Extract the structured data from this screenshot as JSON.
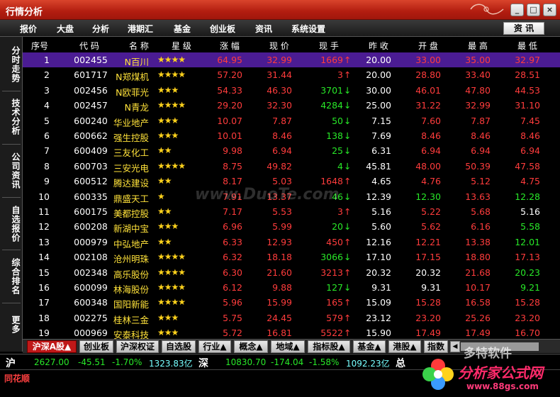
{
  "window": {
    "title": "行情分析",
    "min": "_",
    "max": "□",
    "close": "×"
  },
  "menu": [
    "报价",
    "大盘",
    "分析",
    "港期汇",
    "基金",
    "创业板",
    "资讯",
    "系统设置"
  ],
  "menu_right": "资 讯",
  "left_tabs": [
    "分时走势",
    "技术分析",
    "公司资讯",
    "自选报价",
    "综合排名",
    "更多"
  ],
  "headers": [
    "序号",
    "代 码",
    "名 称",
    "星 级",
    "涨 幅",
    "现 价",
    "现 手",
    "昨 收",
    "开 盘",
    "最 高",
    "最 低"
  ],
  "rows": [
    {
      "no": "1",
      "code": "002455",
      "name": "N百川",
      "stars": "★★★★",
      "chg": "64.95",
      "price": "32.99",
      "vol": "1669",
      "dir": "↑",
      "prev": "20.00",
      "open": "33.00",
      "high": "35.00",
      "low": "32.97",
      "pc": "red",
      "oc": "red",
      "hc": "red",
      "lc": "red",
      "vc": "red"
    },
    {
      "no": "2",
      "code": "601717",
      "name": "N郑煤机",
      "stars": "★★★★",
      "chg": "57.20",
      "price": "31.44",
      "vol": "3",
      "dir": "↑",
      "prev": "20.00",
      "open": "28.80",
      "high": "33.40",
      "low": "28.51",
      "pc": "red",
      "oc": "red",
      "hc": "red",
      "lc": "red",
      "vc": "red"
    },
    {
      "no": "3",
      "code": "002456",
      "name": "N欧菲光",
      "stars": "★★★",
      "chg": "54.33",
      "price": "46.30",
      "vol": "3701",
      "dir": "↓",
      "prev": "30.00",
      "open": "46.01",
      "high": "47.80",
      "low": "44.53",
      "pc": "red",
      "oc": "red",
      "hc": "red",
      "lc": "red",
      "vc": "green"
    },
    {
      "no": "4",
      "code": "002457",
      "name": "N青龙",
      "stars": "★★★★",
      "chg": "29.20",
      "price": "32.30",
      "vol": "4284",
      "dir": "↓",
      "prev": "25.00",
      "open": "31.22",
      "high": "32.99",
      "low": "31.10",
      "pc": "red",
      "oc": "red",
      "hc": "red",
      "lc": "red",
      "vc": "green"
    },
    {
      "no": "5",
      "code": "600240",
      "name": "华业地产",
      "stars": "★★★",
      "chg": "10.07",
      "price": "7.87",
      "vol": "50",
      "dir": "↓",
      "prev": "7.15",
      "open": "7.60",
      "high": "7.87",
      "low": "7.45",
      "pc": "red",
      "oc": "red",
      "hc": "red",
      "lc": "red",
      "vc": "green"
    },
    {
      "no": "6",
      "code": "600662",
      "name": "强生控股",
      "stars": "★★★",
      "chg": "10.01",
      "price": "8.46",
      "vol": "138",
      "dir": "↓",
      "prev": "7.69",
      "open": "8.46",
      "high": "8.46",
      "low": "8.46",
      "pc": "red",
      "oc": "red",
      "hc": "red",
      "lc": "red",
      "vc": "green"
    },
    {
      "no": "7",
      "code": "600409",
      "name": "三友化工",
      "stars": "★★",
      "chg": "9.98",
      "price": "6.94",
      "vol": "25",
      "dir": "↓",
      "prev": "6.31",
      "open": "6.94",
      "high": "6.94",
      "low": "6.94",
      "pc": "red",
      "oc": "red",
      "hc": "red",
      "lc": "red",
      "vc": "green"
    },
    {
      "no": "8",
      "code": "600703",
      "name": "三安光电",
      "stars": "★★★★",
      "chg": "8.75",
      "price": "49.82",
      "vol": "4",
      "dir": "↓",
      "prev": "45.81",
      "open": "48.00",
      "high": "50.39",
      "low": "47.58",
      "pc": "red",
      "oc": "red",
      "hc": "red",
      "lc": "red",
      "vc": "green"
    },
    {
      "no": "9",
      "code": "600512",
      "name": "腾达建设",
      "stars": "★★",
      "chg": "8.17",
      "price": "5.03",
      "vol": "1648",
      "dir": "↑",
      "prev": "4.65",
      "open": "4.76",
      "high": "5.12",
      "low": "4.75",
      "pc": "red",
      "oc": "red",
      "hc": "red",
      "lc": "red",
      "vc": "red"
    },
    {
      "no": "10",
      "code": "600335",
      "name": "鼎盛天工",
      "stars": "★",
      "chg": "7.91",
      "price": "13.37",
      "vol": "46",
      "dir": "↓",
      "prev": "12.39",
      "open": "12.30",
      "high": "13.63",
      "low": "12.28",
      "pc": "red",
      "oc": "green",
      "hc": "red",
      "lc": "green",
      "vc": "green"
    },
    {
      "no": "11",
      "code": "600175",
      "name": "美都控股",
      "stars": "★★",
      "chg": "7.17",
      "price": "5.53",
      "vol": "3",
      "dir": "↑",
      "prev": "5.16",
      "open": "5.22",
      "high": "5.68",
      "low": "5.16",
      "pc": "red",
      "oc": "red",
      "hc": "red",
      "lc": "white",
      "vc": "red"
    },
    {
      "no": "12",
      "code": "600208",
      "name": "新湖中宝",
      "stars": "★★★",
      "chg": "6.96",
      "price": "5.99",
      "vol": "20",
      "dir": "↓",
      "prev": "5.60",
      "open": "5.62",
      "high": "6.16",
      "low": "5.58",
      "pc": "red",
      "oc": "red",
      "hc": "red",
      "lc": "green",
      "vc": "green"
    },
    {
      "no": "13",
      "code": "000979",
      "name": "中弘地产",
      "stars": "★★",
      "chg": "6.33",
      "price": "12.93",
      "vol": "450",
      "dir": "↑",
      "prev": "12.16",
      "open": "12.21",
      "high": "13.38",
      "low": "12.01",
      "pc": "red",
      "oc": "red",
      "hc": "red",
      "lc": "green",
      "vc": "red"
    },
    {
      "no": "14",
      "code": "002108",
      "name": "沧州明珠",
      "stars": "★★★★",
      "chg": "6.32",
      "price": "18.18",
      "vol": "3066",
      "dir": "↓",
      "prev": "17.10",
      "open": "17.15",
      "high": "18.80",
      "low": "17.13",
      "pc": "red",
      "oc": "red",
      "hc": "red",
      "lc": "red",
      "vc": "green"
    },
    {
      "no": "15",
      "code": "002348",
      "name": "高乐股份",
      "stars": "★★★★",
      "chg": "6.30",
      "price": "21.60",
      "vol": "3213",
      "dir": "↑",
      "prev": "20.32",
      "open": "20.32",
      "high": "21.68",
      "low": "20.23",
      "pc": "red",
      "oc": "white",
      "hc": "red",
      "lc": "green",
      "vc": "red"
    },
    {
      "no": "16",
      "code": "600099",
      "name": "林海股份",
      "stars": "★★★★",
      "chg": "6.12",
      "price": "9.88",
      "vol": "127",
      "dir": "↓",
      "prev": "9.31",
      "open": "9.31",
      "high": "10.17",
      "low": "9.21",
      "pc": "red",
      "oc": "white",
      "hc": "red",
      "lc": "green",
      "vc": "green"
    },
    {
      "no": "17",
      "code": "600348",
      "name": "国阳新能",
      "stars": "★★★★",
      "chg": "5.96",
      "price": "15.99",
      "vol": "165",
      "dir": "↑",
      "prev": "15.09",
      "open": "15.28",
      "high": "16.58",
      "low": "15.28",
      "pc": "red",
      "oc": "red",
      "hc": "red",
      "lc": "red",
      "vc": "red"
    },
    {
      "no": "18",
      "code": "002275",
      "name": "桂林三金",
      "stars": "★★★",
      "chg": "5.75",
      "price": "24.45",
      "vol": "579",
      "dir": "↑",
      "prev": "23.12",
      "open": "23.20",
      "high": "25.26",
      "low": "23.20",
      "pc": "red",
      "oc": "red",
      "hc": "red",
      "lc": "red",
      "vc": "red"
    },
    {
      "no": "19",
      "code": "000969",
      "name": "安泰科技",
      "stars": "★★★",
      "chg": "5.72",
      "price": "16.81",
      "vol": "5522",
      "dir": "↑",
      "prev": "15.90",
      "open": "17.49",
      "high": "17.49",
      "low": "16.70",
      "pc": "red",
      "oc": "red",
      "hc": "red",
      "lc": "red",
      "vc": "red"
    }
  ],
  "bottom_tabs": [
    "沪深A股▲",
    "创业板",
    "沪深权证",
    "自选股",
    "行业▲",
    "概念▲",
    "地域▲",
    "指标股▲",
    "基金▲",
    "港股▲",
    "指数"
  ],
  "status": {
    "sh_label": "沪",
    "sh_index": "2627.00",
    "sh_chg": "-45.51",
    "sh_pct": "-1.70%",
    "sh_amt": "1323.83亿",
    "sz_label": "深",
    "sz_index": "10830.70",
    "sz_chg": "-174.04",
    "sz_pct": "-1.58%",
    "sz_amt": "1092.23亿",
    "total_label": "总"
  },
  "brand": "同花顺",
  "watermark": "www.DuoTe.com",
  "logo": {
    "cn1": "多特软件",
    "cn2": "分析家公式网",
    "url": "www.88gs.com"
  }
}
